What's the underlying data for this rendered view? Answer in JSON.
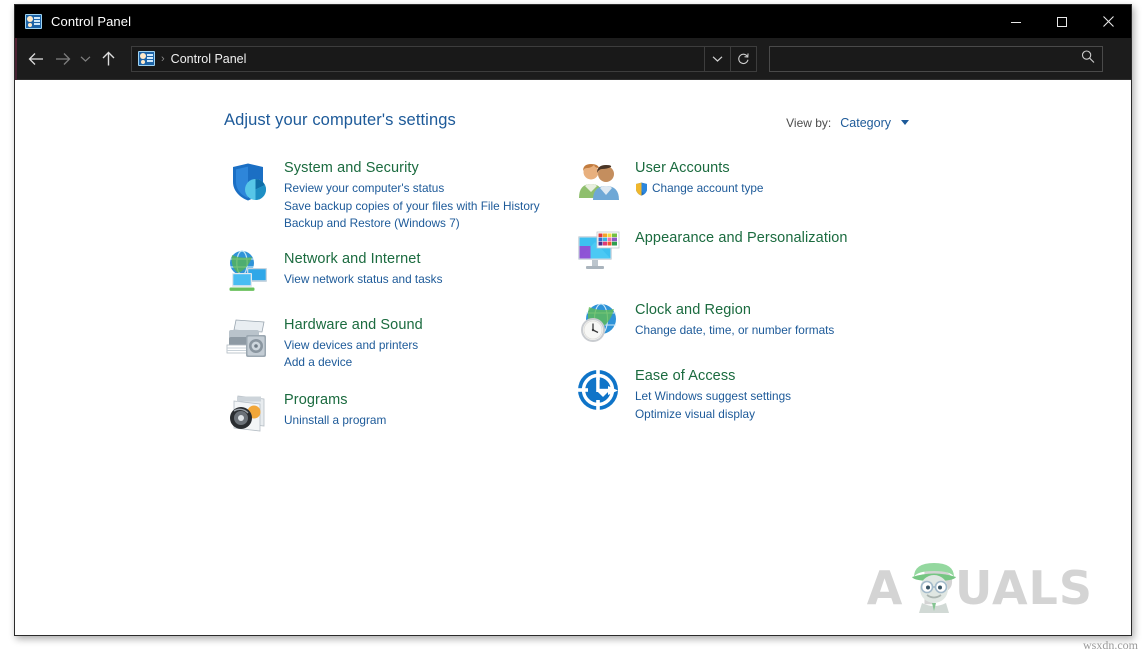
{
  "window": {
    "title": "Control Panel",
    "title_icon": "control-panel-icon",
    "controls": {
      "minimize": "minimize-icon",
      "maximize": "maximize-icon",
      "close": "close-icon"
    }
  },
  "navbar": {
    "back": "back-arrow-icon",
    "forward": "forward-arrow-icon",
    "recent": "recent-locations-chevron-icon",
    "up": "up-arrow-icon",
    "breadcrumb": {
      "icon": "control-panel-icon",
      "separator": "›",
      "path": "Control Panel"
    },
    "dropdown": "address-dropdown-chevron-icon",
    "refresh": "refresh-icon",
    "search": {
      "value": "",
      "placeholder": "",
      "icon": "search-magnifier-icon"
    }
  },
  "content": {
    "page_title": "Adjust your computer's settings",
    "view_by": {
      "label": "View by:",
      "value": "Category",
      "caret": "chevron-down-icon"
    },
    "left_column": [
      {
        "icon": "shield-chart-icon",
        "title": "System and Security",
        "links": [
          {
            "text": "Review your computer's status",
            "shield": false
          },
          {
            "text": "Save backup copies of your files with File History",
            "shield": false
          },
          {
            "text": "Backup and Restore (Windows 7)",
            "shield": false
          }
        ]
      },
      {
        "icon": "globe-monitors-icon",
        "title": "Network and Internet",
        "links": [
          {
            "text": "View network status and tasks",
            "shield": false
          }
        ]
      },
      {
        "icon": "printer-speaker-icon",
        "title": "Hardware and Sound",
        "links": [
          {
            "text": "View devices and printers",
            "shield": false
          },
          {
            "text": "Add a device",
            "shield": false
          }
        ]
      },
      {
        "icon": "program-disc-icon",
        "title": "Programs",
        "links": [
          {
            "text": "Uninstall a program",
            "shield": false
          }
        ]
      }
    ],
    "right_column": [
      {
        "icon": "user-accounts-people-icon",
        "title": "User Accounts",
        "links": [
          {
            "text": "Change account type",
            "shield": true
          }
        ]
      },
      {
        "icon": "monitor-palette-icon",
        "title": "Appearance and Personalization",
        "links": []
      },
      {
        "icon": "clock-globe-icon",
        "title": "Clock and Region",
        "links": [
          {
            "text": "Change date, time, or number formats",
            "shield": false
          }
        ]
      },
      {
        "icon": "ease-of-access-icon",
        "title": "Ease of Access",
        "links": [
          {
            "text": "Let Windows suggest settings",
            "shield": false
          },
          {
            "text": "Optimize visual display",
            "shield": false
          }
        ]
      }
    ]
  },
  "watermark": {
    "brand": "A   PUALS",
    "face_icon": "appuals-mascot-icon"
  },
  "footer": {
    "credit": "wsxdn.com"
  },
  "colors": {
    "titlebar_bg": "#000000",
    "navbar_bg": "#1c1c1c",
    "category_title": "#1b6b3f",
    "link": "#1d5a99",
    "page_title": "#1d5a99",
    "content_bg": "#ffffff"
  }
}
